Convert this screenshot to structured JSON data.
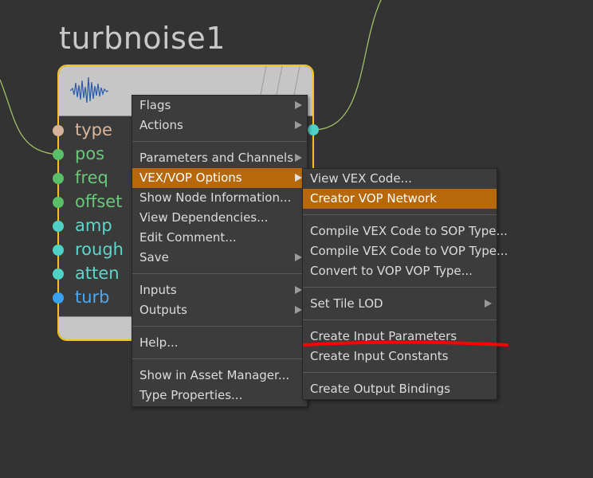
{
  "node": {
    "title": "turbnoise1",
    "inputs": [
      {
        "name": "type",
        "color": "#d4b39a",
        "label_color": "#d8b79e"
      },
      {
        "name": "pos",
        "color": "#5bbf6a",
        "label_color": "#6ac87a"
      },
      {
        "name": "freq",
        "color": "#5bbf6a",
        "label_color": "#6ac87a"
      },
      {
        "name": "offset",
        "color": "#5bbf6a",
        "label_color": "#6ac87a"
      },
      {
        "name": "amp",
        "color": "#4fd1c5",
        "label_color": "#5fd6cb"
      },
      {
        "name": "rough",
        "color": "#4fd1c5",
        "label_color": "#5fd6cb"
      },
      {
        "name": "atten",
        "color": "#4fd1c5",
        "label_color": "#5fd6cb"
      },
      {
        "name": "turb",
        "color": "#3aa0f0",
        "label_color": "#4aa8f2"
      }
    ],
    "output_color": "#4fd1c5",
    "border_color": "#f0c419"
  },
  "context_menu": {
    "items": {
      "flags": "Flags",
      "actions": "Actions",
      "parameters_channels": "Parameters and Channels",
      "vex_vop_options": "VEX/VOP Options",
      "show_node_info": "Show Node Information...",
      "view_dependencies": "View Dependencies...",
      "edit_comment": "Edit Comment...",
      "save": "Save",
      "inputs": "Inputs",
      "outputs": "Outputs",
      "help": "Help...",
      "show_in_asset_manager": "Show in Asset Manager...",
      "type_properties": "Type Properties..."
    }
  },
  "submenu": {
    "items": {
      "view_vex_code": "View VEX Code...",
      "creator_vop_network": "Creator VOP Network",
      "compile_vex_sop": "Compile VEX Code to SOP Type...",
      "compile_vex_vop": "Compile VEX Code to VOP Type...",
      "convert_vop_vop": "Convert to VOP VOP Type...",
      "set_tile_lod": "Set Tile LOD",
      "create_input_parameters": "Create Input Parameters",
      "create_input_constants": "Create Input Constants",
      "create_output_bindings": "Create Output Bindings"
    }
  },
  "colors": {
    "menu_highlight": "#b7680b",
    "wire": "#a8c86a",
    "annotation": "#ff0000"
  }
}
